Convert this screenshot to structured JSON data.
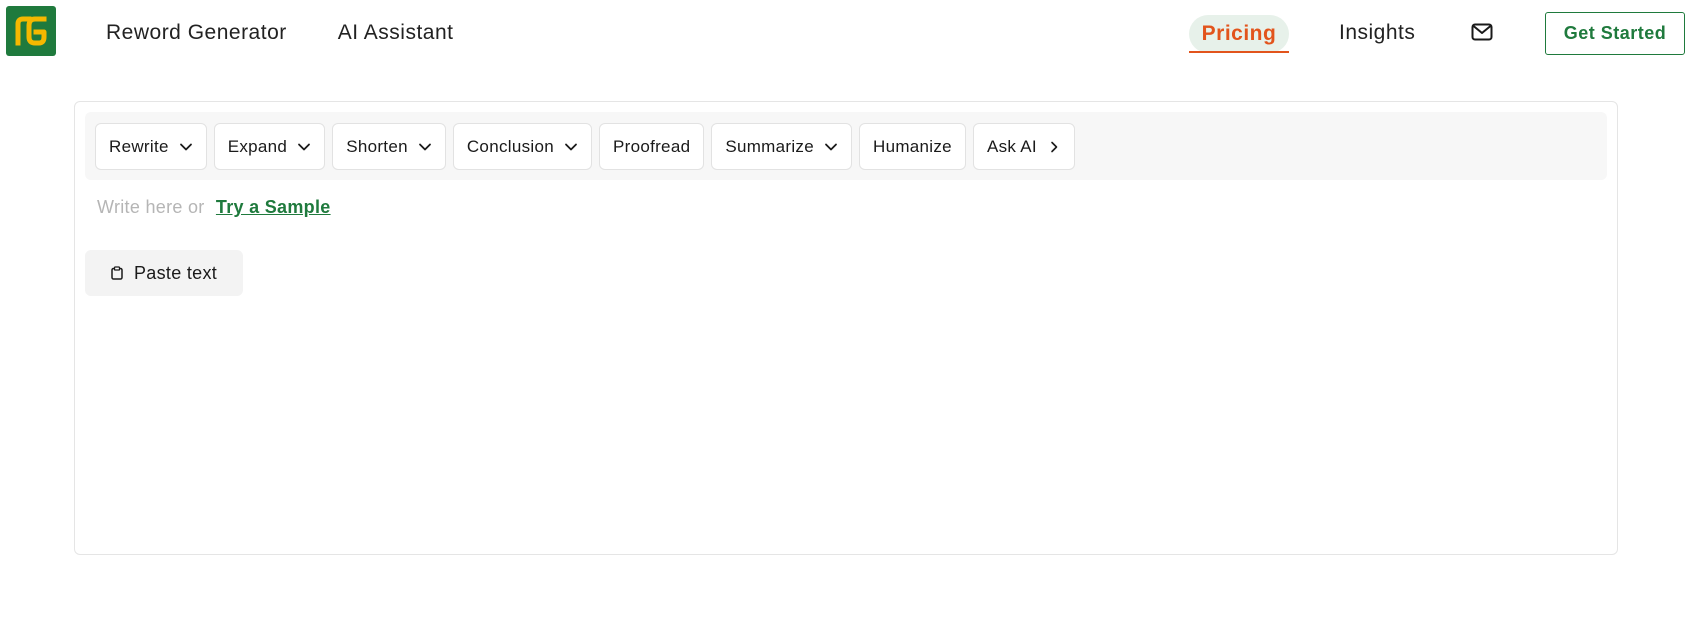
{
  "header": {
    "logo_icon": "reword-generator-logo",
    "nav_left": [
      {
        "label": "Reword Generator"
      },
      {
        "label": "AI Assistant"
      }
    ],
    "pricing_label": "Pricing",
    "insights_label": "Insights",
    "mail_icon": "mail-icon",
    "get_started_label": "Get Started"
  },
  "toolbar": {
    "tools": [
      {
        "label": "Rewrite",
        "icon": "chevron-down-icon"
      },
      {
        "label": "Expand",
        "icon": "chevron-down-icon"
      },
      {
        "label": "Shorten",
        "icon": "chevron-down-icon"
      },
      {
        "label": "Conclusion",
        "icon": "chevron-down-icon"
      },
      {
        "label": "Proofread",
        "icon": ""
      },
      {
        "label": "Summarize",
        "icon": "chevron-down-icon"
      },
      {
        "label": "Humanize",
        "icon": ""
      },
      {
        "label": "Ask AI",
        "icon": "chevron-right-icon"
      }
    ]
  },
  "editor": {
    "placeholder": "Write here or",
    "sample_link": "Try a Sample",
    "paste_label": "Paste text",
    "paste_icon": "clipboard-icon"
  },
  "colors": {
    "brand_green": "#1f7a3d",
    "accent_orange": "#e2541c",
    "logo_yellow": "#f5b800",
    "pricing_bg": "#e7f1ea"
  }
}
